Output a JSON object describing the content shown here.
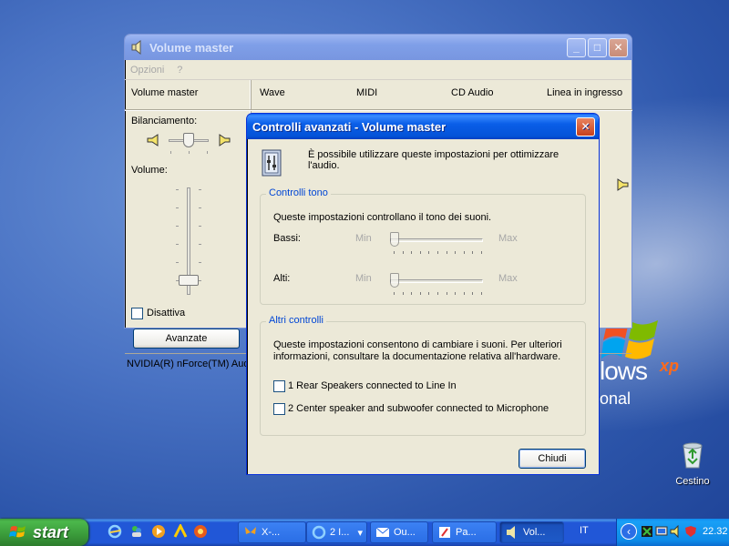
{
  "desktop": {
    "windows_text": "lows",
    "xp_text": "xp",
    "edition_text": "onal",
    "recycle_bin_label": "Cestino"
  },
  "volume_master": {
    "title": "Volume master",
    "menu": [
      "Opzioni",
      "?"
    ],
    "columns": [
      "Volume master",
      "Wave",
      "MIDI",
      "CD Audio",
      "Linea in ingresso"
    ],
    "balance_label": "Bilanciamento:",
    "volume_label": "Volume:",
    "mute_label": "Disattiva",
    "mute_checked": false,
    "advanced_button": "Avanzate",
    "status": "NVIDIA(R) nForce(TM) Aud"
  },
  "dialog": {
    "title": "Controlli avanzati - Volume master",
    "intro": "È possibile utilizzare queste impostazioni per ottimizzare l'audio.",
    "tone_group": {
      "legend": "Controlli tono",
      "description": "Queste impostazioni controllano il tono dei suoni.",
      "bass_label": "Bassi:",
      "treble_label": "Alti:",
      "min_label": "Min",
      "max_label": "Max",
      "bass_value": 0,
      "treble_value": 0
    },
    "other_group": {
      "legend": "Altri controlli",
      "description": "Queste impostazioni consentono di cambiare i suoni. Per ulteriori informazioni, consultare la documentazione relativa all'hardware.",
      "options": [
        {
          "label": "1  Rear Speakers connected to Line In",
          "checked": false
        },
        {
          "label": "2  Center speaker and subwoofer connected to Microphone",
          "checked": false
        }
      ]
    },
    "close_button": "Chiudi"
  },
  "taskbar": {
    "start_label": "start",
    "tasks": [
      {
        "label": "X-...",
        "active": false
      },
      {
        "label": "2 I...",
        "active": false
      },
      {
        "label": "Ou...",
        "active": false
      },
      {
        "label": "Pa...",
        "active": false
      },
      {
        "label": "Vol...",
        "active": true
      }
    ],
    "language": "IT",
    "clock": "22.32"
  },
  "colors": {
    "titlebar_blue": "#0453d8",
    "window_face": "#ece9d8",
    "group_legend": "#0046d5",
    "start_green": "#3a9a3a"
  }
}
